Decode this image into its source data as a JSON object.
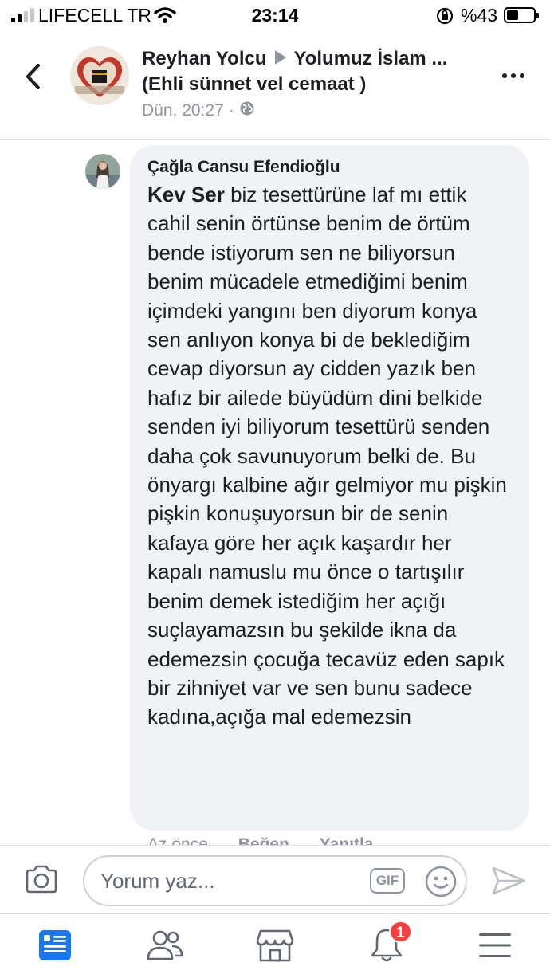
{
  "status_bar": {
    "carrier": "LIFECELL TR",
    "time": "23:14",
    "battery_pct": "%43",
    "battery_level": 0.43,
    "icons": [
      "signal-icon",
      "wifi-icon",
      "rotation-lock-icon",
      "battery-icon"
    ]
  },
  "header": {
    "author": "Reyhan Yolcu",
    "group_line1": "Yolumuz İslam ...",
    "group_line2": "(Ehli sünnet vel cemaat )",
    "timestamp": "Dün, 20:27",
    "separator": "·",
    "audience_icon": "globe-icon"
  },
  "comment": {
    "author": "Çağla Cansu Efendioğlu",
    "mention": "Kev Ser",
    "text": " biz tesettürüne laf mı ettik cahil senin örtünse benim de örtüm bende istiyorum sen ne biliyorsun benim mücadele etmediğimi benim içimdeki yangını ben diyorum konya sen anlıyon konya bi de beklediğim cevap diyorsun ay cidden yazık ben hafız bir ailede büyüdüm dini belkide senden iyi biliyorum tesettürü senden daha çok savunuyorum belki de. Bu önyargı kalbine ağır gelmiyor mu pişkin pişkin konuşuyorsun bir de senin kafaya göre her açık kaşardır her kapalı namuslu mu önce o tartışılır benim demek istediğim her açığı suçlayamazsın bu şekilde ikna da edemezsin çocuğa tecavüz eden sapık bir zihniyet var ve sen bunu sadece kadına,açığa mal edemezsin",
    "actions": {
      "time": "Az önce",
      "like": "Beğen",
      "reply": "Yanıtla"
    }
  },
  "composer": {
    "placeholder": "Yorum yaz...",
    "gif_label": "GIF"
  },
  "bottom_nav": {
    "items": [
      "news-feed-icon",
      "friends-icon",
      "marketplace-icon",
      "notifications-icon",
      "menu-icon"
    ],
    "notifications_badge": "1"
  },
  "colors": {
    "accent": "#1877f2",
    "badge": "#fa3e3e",
    "bubble": "#f0f2f5",
    "muted": "#90949c"
  }
}
